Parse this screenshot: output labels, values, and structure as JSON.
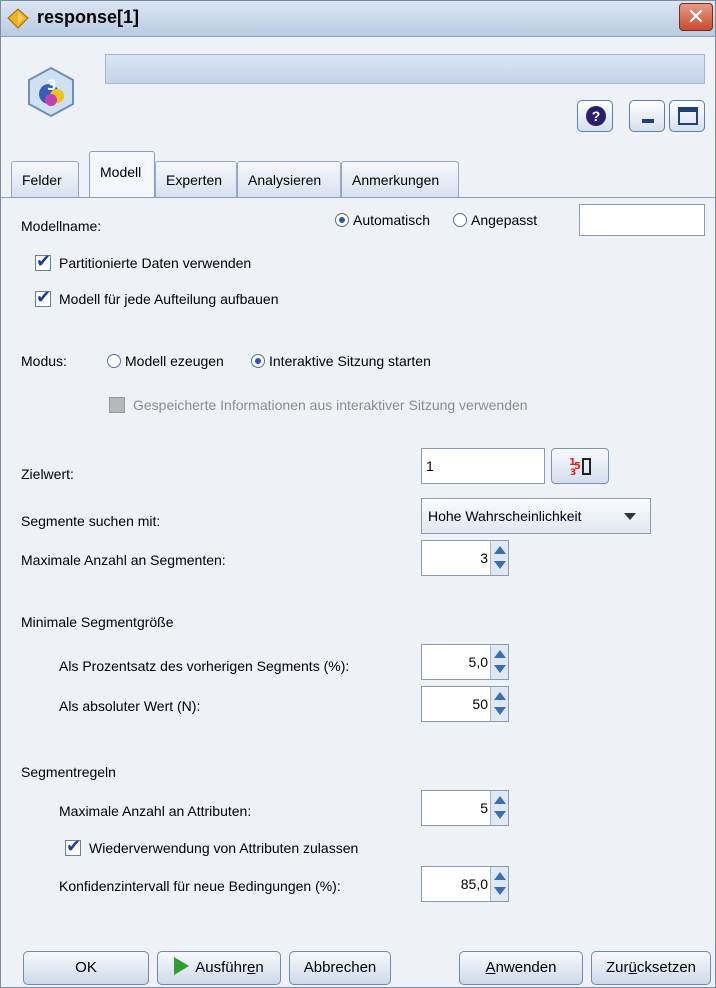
{
  "window": {
    "title": "response[1]",
    "close_glyph": "✕"
  },
  "header": {
    "help_glyph": "?"
  },
  "tabs": [
    {
      "label": "Felder"
    },
    {
      "label": "Modell"
    },
    {
      "label": "Experten"
    },
    {
      "label": "Analysieren"
    },
    {
      "label": "Anmerkungen"
    }
  ],
  "model": {
    "model_name_label": "Modellname:",
    "auto_label": "Automatisch",
    "custom_label": "Angepasst",
    "custom_value": "",
    "use_partitioned_label": "Partitionierte Daten verwenden",
    "build_per_split_label": "Modell für jede Aufteilung aufbauen",
    "mode_label": "Modus:",
    "mode_generate_label": "Modell ezeugen",
    "mode_interactive_label": "Interaktive Sitzung starten",
    "use_saved_label": "Gespeicherte Informationen aus interaktiver Sitzung verwenden",
    "target_label": "Zielwert:",
    "target_value": "1",
    "search_label": "Segmente suchen mit:",
    "search_value": "Hohe Wahrscheinlichkeit",
    "max_segments_label": "Maximale Anzahl an Segmenten:",
    "max_segments_value": "3",
    "min_size_heading": "Minimale Segmentgröße",
    "pct_prev_label": "Als Prozentsatz des vorherigen Segments (%):",
    "pct_prev_value": "5,0",
    "abs_label": "Als absoluter Wert (N):",
    "abs_value": "50",
    "rules_heading": "Segmentregeln",
    "max_attrs_label": "Maximale Anzahl an Attributen:",
    "max_attrs_value": "5",
    "reuse_attrs_label": "Wiederverwendung von Attributen zulassen",
    "confidence_label": "Konfidenzintervall für neue Bedingungen (%):",
    "confidence_value": "85,0"
  },
  "buttons": {
    "ok": "OK",
    "run_pre": "Ausführ",
    "run_u": "e",
    "run_post": "n",
    "cancel": "Abbrechen",
    "apply_u": "A",
    "apply_post": "nwenden",
    "reset_pre": "Zur",
    "reset_u": "ü",
    "reset_post": "cksetzen"
  },
  "colors": {
    "accent": "#2a56b8",
    "run_icon": "#2f9d2f",
    "close": "#c84a2e"
  }
}
